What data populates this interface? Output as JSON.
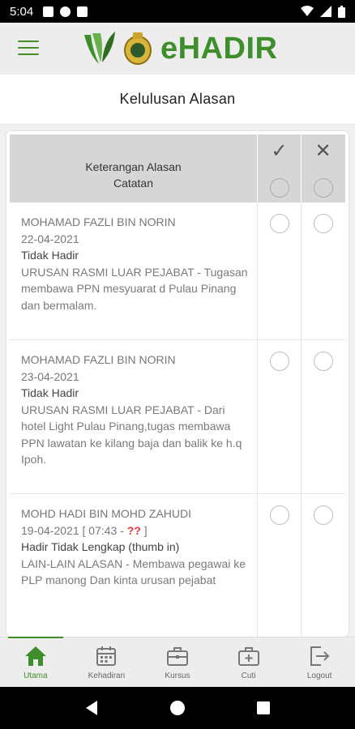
{
  "status_bar": {
    "time": "5:04"
  },
  "header": {
    "logo_text": "eHADIR"
  },
  "page": {
    "title": "Kelulusan Alasan"
  },
  "table": {
    "head_desc_line1": "Keterangan Alasan",
    "head_desc_line2": "Catatan",
    "approve_glyph": "✓",
    "reject_glyph": "✕",
    "rows": [
      {
        "name": "MOHAMAD FAZLI BIN NORIN",
        "date": "22-04-2021",
        "status": "Tidak Hadir",
        "reason": "URUSAN RASMI LUAR PEJABAT - Tugasan membawa PPN mesyuarat d Pulau Pinang dan bermalam."
      },
      {
        "name": "MOHAMAD FAZLI BIN NORIN",
        "date": "23-04-2021",
        "status": "Tidak Hadir",
        "reason": "URUSAN RASMI LUAR PEJABAT - Dari hotel Light Pulau Pinang,tugas membawa PPN lawatan ke kilang baja dan balik ke h.q Ipoh."
      },
      {
        "name": "MOHD HADI BIN MOHD ZAHUDI",
        "date": "19-04-2021 [ 07:43 - ",
        "date_flag": "??",
        "date_end": " ]",
        "status": "Hadir Tidak Lengkap (thumb in)",
        "reason": "LAIN-LAIN ALASAN - Membawa pegawai ke PLP manong Dan kinta urusan pejabat"
      }
    ]
  },
  "bottom_nav": [
    {
      "label": "Utama",
      "icon": "home-icon"
    },
    {
      "label": "Kehadiran",
      "icon": "calendar-icon"
    },
    {
      "label": "Kursus",
      "icon": "briefcase-icon"
    },
    {
      "label": "Cuti",
      "icon": "medical-bag-icon"
    },
    {
      "label": "Logout",
      "icon": "logout-icon"
    }
  ],
  "colors": {
    "brand_green": "#3f8e2c",
    "flag_red": "#e53935",
    "header_bg": "#ededed"
  }
}
